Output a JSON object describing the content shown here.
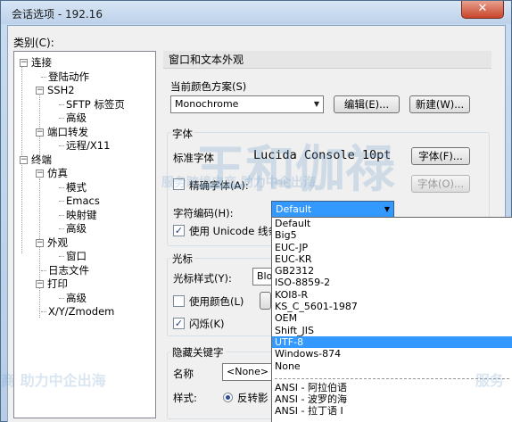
{
  "window": {
    "title": "会话选项 - 192.16",
    "close_label": "✕"
  },
  "sidebar": {
    "category_label": "类别(C):",
    "items": [
      {
        "label": "连接",
        "level": 0,
        "expander": "−"
      },
      {
        "label": "登陆动作",
        "level": 1
      },
      {
        "label": "SSH2",
        "level": 1,
        "expander": "−"
      },
      {
        "label": "SFTP 标签页",
        "level": 2
      },
      {
        "label": "高级",
        "level": 2
      },
      {
        "label": "端口转发",
        "level": 1,
        "expander": "−"
      },
      {
        "label": "远程/X11",
        "level": 2
      },
      {
        "label": "终端",
        "level": 0,
        "expander": "−"
      },
      {
        "label": "仿真",
        "level": 1,
        "expander": "−"
      },
      {
        "label": "模式",
        "level": 2
      },
      {
        "label": "Emacs",
        "level": 2
      },
      {
        "label": "映射键",
        "level": 2
      },
      {
        "label": "高级",
        "level": 2
      },
      {
        "label": "外观",
        "level": 1,
        "expander": "−"
      },
      {
        "label": "窗口",
        "level": 2
      },
      {
        "label": "日志文件",
        "level": 1
      },
      {
        "label": "打印",
        "level": 1,
        "expander": "−"
      },
      {
        "label": "高级",
        "level": 2
      },
      {
        "label": "X/Y/Zmodem",
        "level": 1
      }
    ]
  },
  "main": {
    "section_title": "窗口和文本外观",
    "color_scheme": {
      "label": "当前颜色方案(S)",
      "value": "Monochrome",
      "edit_button": "编辑(E)...",
      "new_button": "新建(W)..."
    },
    "font": {
      "group_title": "字体",
      "standard_label": "标准字体",
      "standard_value": "Lucida Console 10pt",
      "font_button": "字体(F)...",
      "precise_label": "精确字体(A):",
      "precise_button": "字体(O)...",
      "encoding_label": "字符编码(H):",
      "encoding_value": "Default",
      "unicode_label": "使用 Unicode 线条"
    },
    "cursor": {
      "group_title": "光标",
      "style_label": "光标样式(Y):",
      "style_value": "Bloc",
      "use_color_label": "使用颜色(L)",
      "blink_label": "闪烁(K)"
    },
    "hide_key": {
      "group_title": "隐藏关键字",
      "name_label": "名称",
      "name_value": "<None>",
      "style_label": "样式:",
      "style_value": "反转影"
    }
  },
  "encoding_dropdown": {
    "items": [
      "Default",
      "Big5",
      "EUC-JP",
      "EUC-KR",
      "GB2312",
      "ISO-8859-2",
      "KOI8-R",
      "KS_C_5601-1987",
      "OEM",
      "Shift_JIS",
      "UTF-8",
      "Windows-874",
      "None"
    ],
    "selected": "UTF-8",
    "ansi_items": [
      "ANSI - 阿拉伯语",
      "ANSI - 波罗的海",
      "ANSI - 拉丁语 I"
    ]
  },
  "watermark": {
    "brand": "王和伽禄",
    "slogan_a": "服务跨境电商 助力中企出海",
    "slogan_b": "商 助力中企出海",
    "slogan_c": "服务"
  },
  "colors": {
    "selection": "#3399ff",
    "close_button": "#c8452b"
  }
}
